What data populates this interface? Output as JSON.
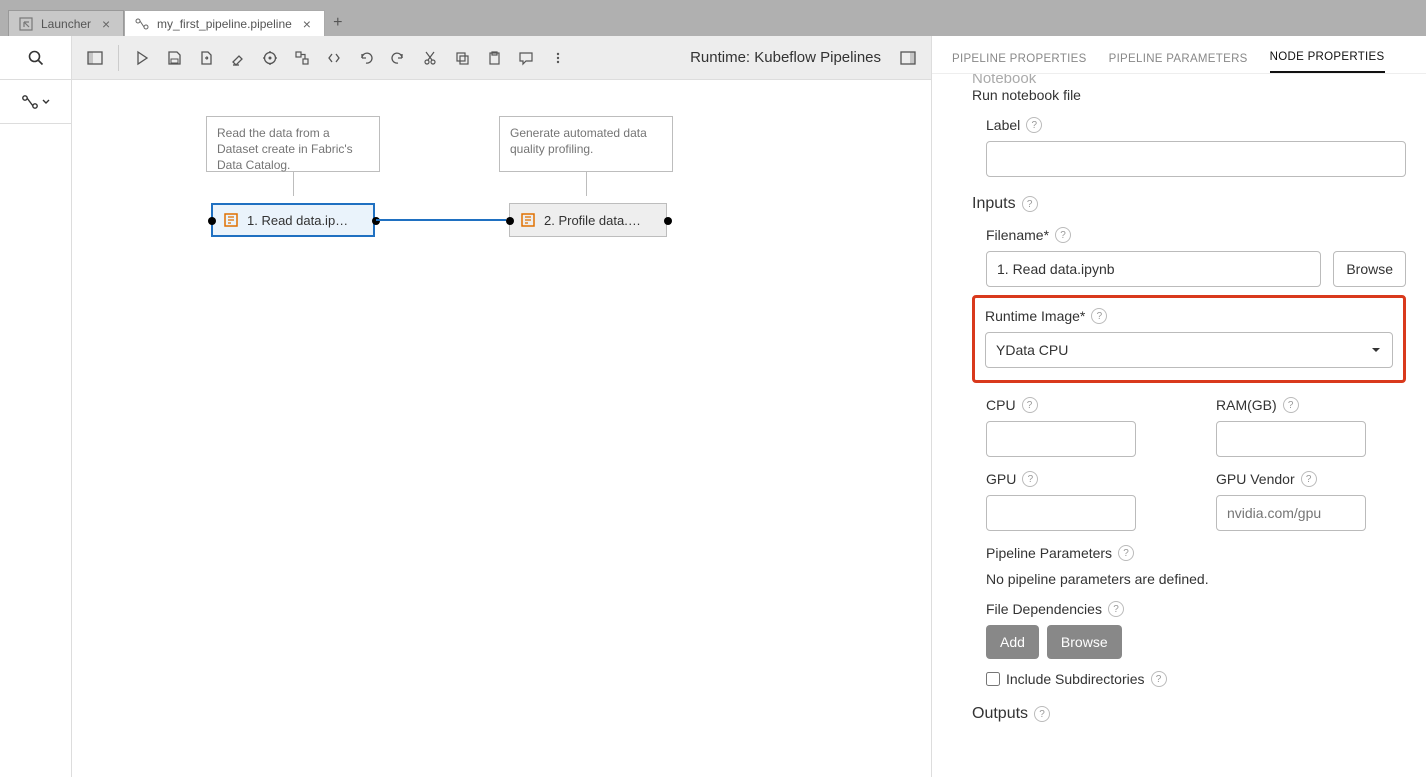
{
  "tabs": [
    {
      "label": "Launcher",
      "icon": "launcher"
    },
    {
      "label": "my_first_pipeline.pipeline",
      "icon": "pipeline"
    }
  ],
  "toolbar": {
    "runtime": "Runtime: Kubeflow Pipelines"
  },
  "canvas": {
    "comment1": "Read the data from a Dataset create in Fabric's Data Catalog.",
    "comment2": "Generate automated data quality profiling.",
    "node1": "1. Read data.ip…",
    "node2": "2. Profile data.…"
  },
  "props": {
    "tab_pipeline": "PIPELINE PROPERTIES",
    "tab_params": "PIPELINE PARAMETERS",
    "tab_node": "NODE PROPERTIES",
    "notebook_head": "Notebook",
    "notebook_desc": "Run notebook file",
    "label": "Label",
    "inputs": "Inputs",
    "filename": "Filename*",
    "filename_value": "1. Read data.ipynb",
    "browse": "Browse",
    "runtime_image": "Runtime Image*",
    "runtime_image_value": "YData CPU",
    "cpu": "CPU",
    "ram": "RAM(GB)",
    "gpu": "GPU",
    "gpu_vendor": "GPU Vendor",
    "gpu_vendor_placeholder": "nvidia.com/gpu",
    "pipeline_params": "Pipeline Parameters",
    "no_params": "No pipeline parameters are defined.",
    "file_deps": "File Dependencies",
    "add": "Add",
    "include_sub": "Include Subdirectories",
    "outputs": "Outputs"
  }
}
